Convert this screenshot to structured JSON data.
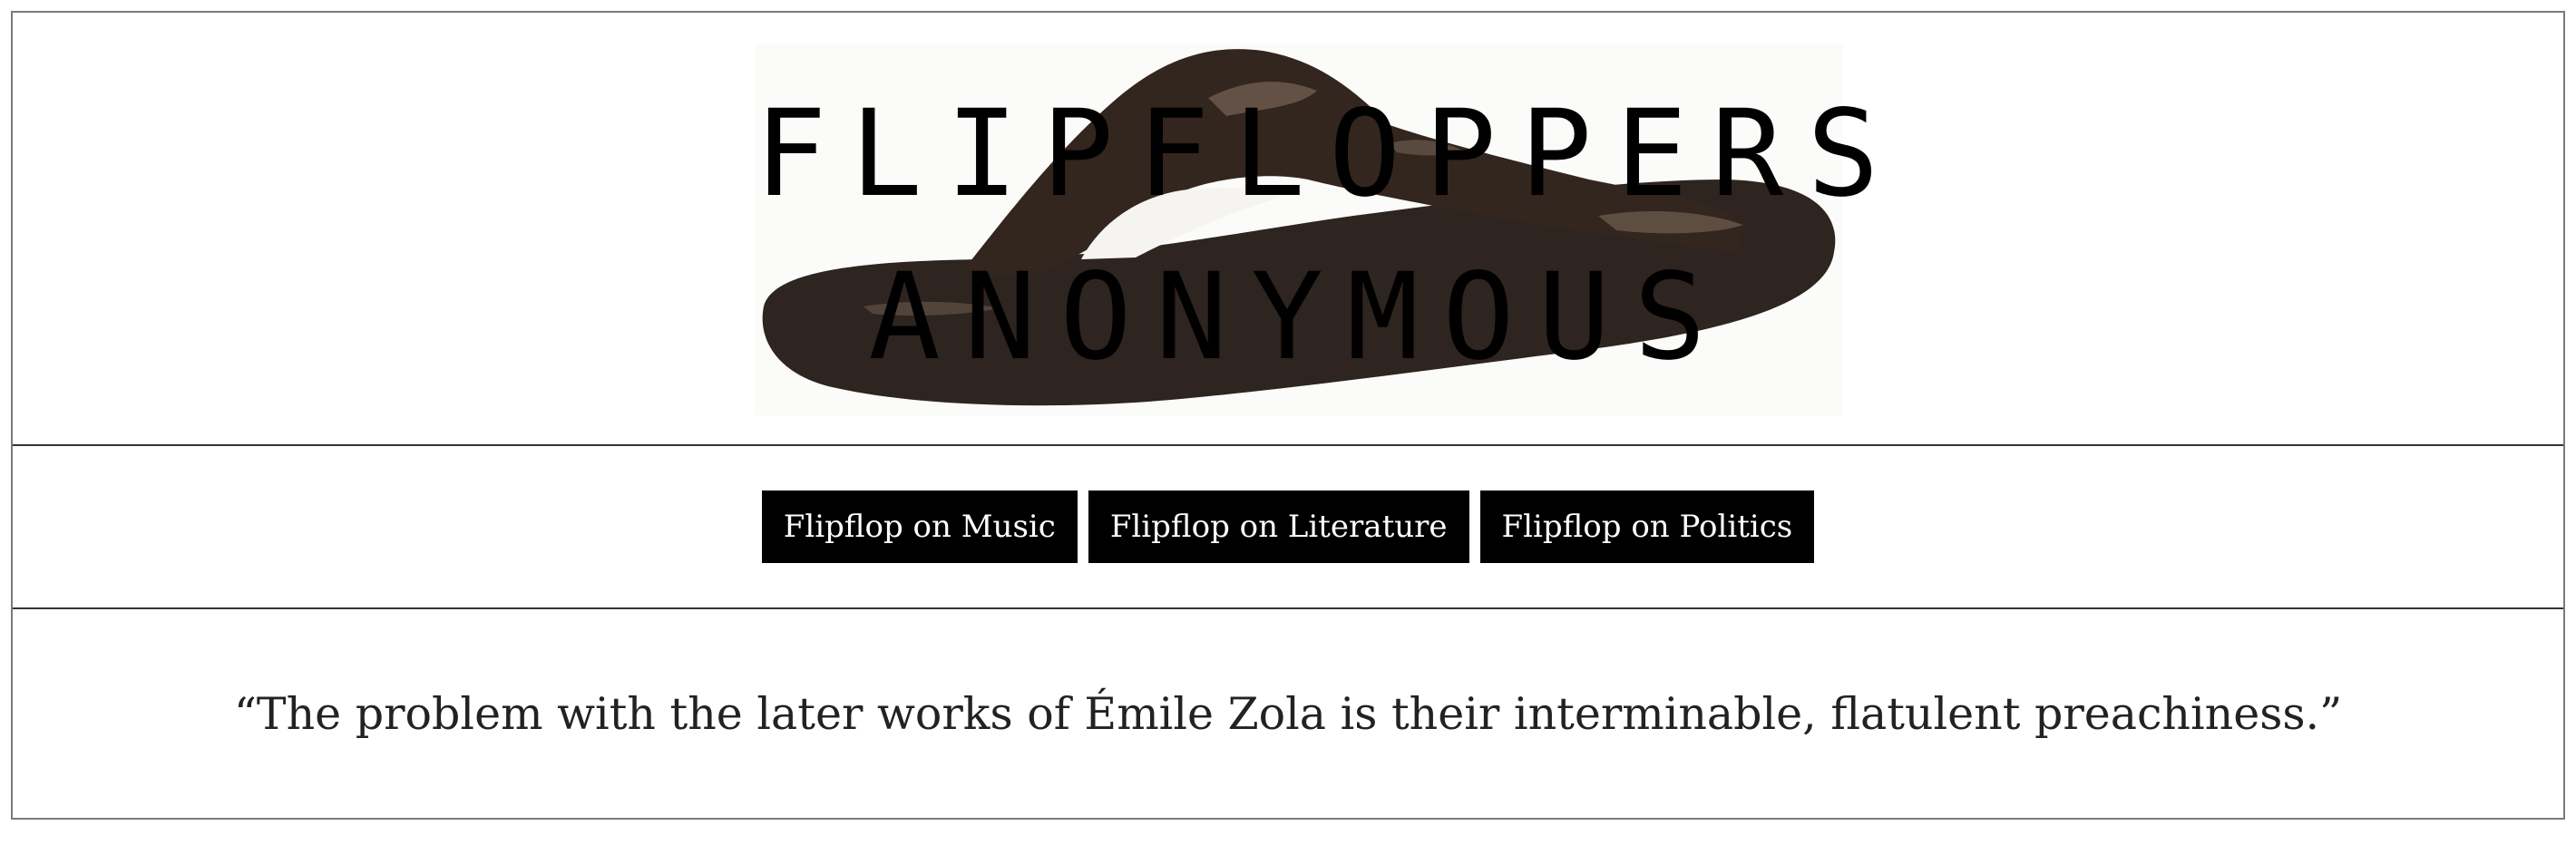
{
  "header": {
    "logo_line_1": "FLIPFLOPPERS",
    "logo_line_2": "ANONYMOUS",
    "logo_image": "flip-flop-sandal"
  },
  "nav": {
    "items": [
      {
        "label": "Flipflop on Music"
      },
      {
        "label": "Flipflop on Literature"
      },
      {
        "label": "Flipflop on Politics"
      }
    ]
  },
  "quote": {
    "text": "“The problem with the later works of Émile Zola is their interminable, flatulent preachiness.”"
  },
  "colors": {
    "sandal": "#2e2420",
    "sandal_highlight": "#8a7565",
    "button_bg": "#000000",
    "button_text": "#ffffff",
    "border": "#333333"
  }
}
